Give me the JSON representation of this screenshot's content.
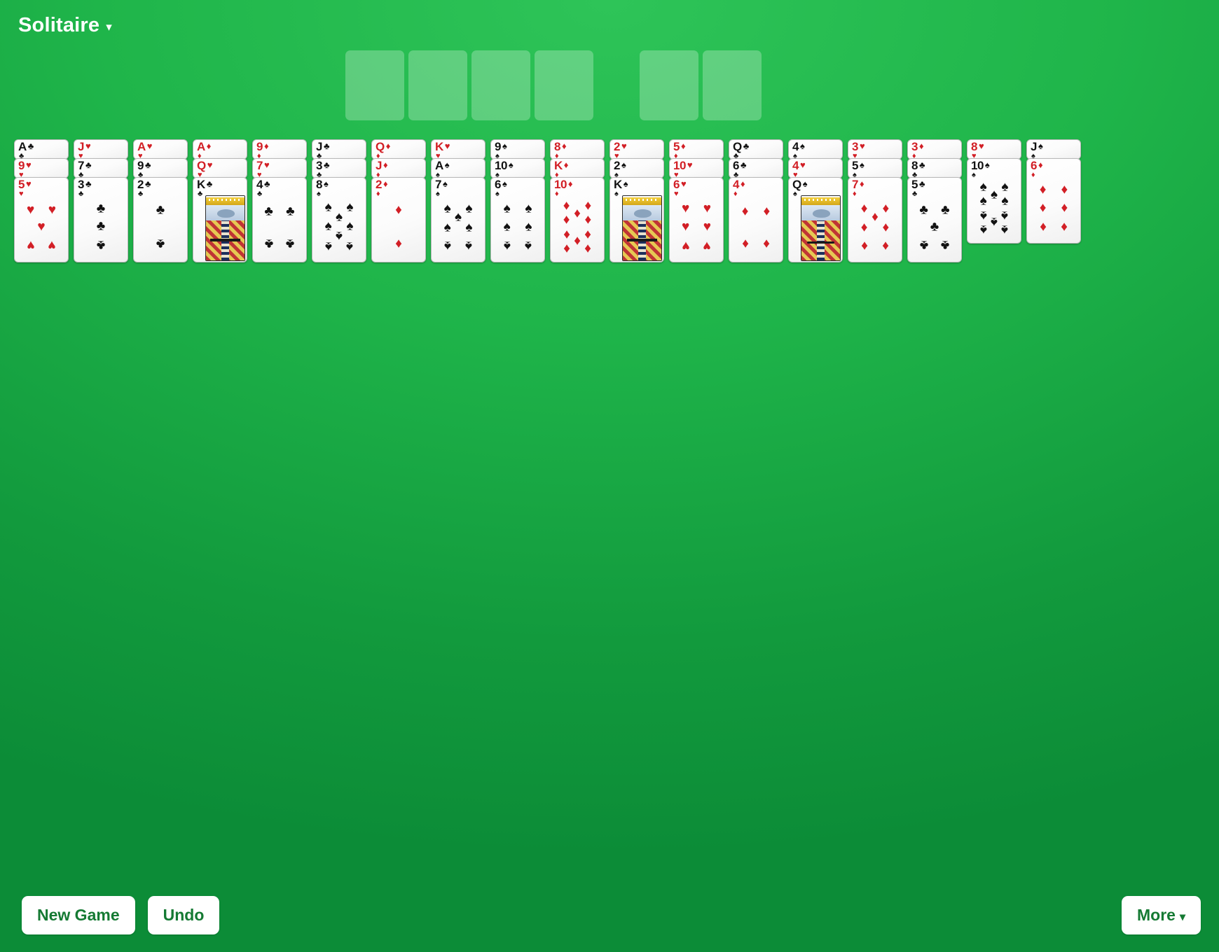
{
  "app": {
    "title": "Solitaire",
    "menu_caret": "▾",
    "table_color": "#1fb54a",
    "card_red": "#d21f26",
    "card_black": "#121212",
    "button_text_color": "#157a33"
  },
  "foundations": {
    "label": "foundation-piles",
    "slots": [
      {
        "id": "foundation-1",
        "card": ""
      },
      {
        "id": "foundation-2",
        "card": ""
      },
      {
        "id": "foundation-3",
        "card": ""
      },
      {
        "id": "foundation-4",
        "card": ""
      },
      {
        "id": "foundation-5",
        "card": "",
        "gap_before": true
      },
      {
        "id": "foundation-6",
        "card": ""
      }
    ]
  },
  "tableau": {
    "columns": [
      {
        "index": 1,
        "cards": [
          {
            "rank": "A",
            "suit": "♣",
            "color": "black"
          },
          {
            "rank": "9",
            "suit": "♥",
            "color": "red"
          },
          {
            "rank": "5",
            "suit": "♥",
            "color": "red"
          }
        ]
      },
      {
        "index": 2,
        "cards": [
          {
            "rank": "J",
            "suit": "♥",
            "color": "red"
          },
          {
            "rank": "7",
            "suit": "♣",
            "color": "black"
          },
          {
            "rank": "3",
            "suit": "♣",
            "color": "black"
          }
        ]
      },
      {
        "index": 3,
        "cards": [
          {
            "rank": "A",
            "suit": "♥",
            "color": "red"
          },
          {
            "rank": "9",
            "suit": "♣",
            "color": "black"
          },
          {
            "rank": "2",
            "suit": "♣",
            "color": "black"
          }
        ]
      },
      {
        "index": 4,
        "cards": [
          {
            "rank": "A",
            "suit": "♦",
            "color": "red"
          },
          {
            "rank": "Q",
            "suit": "♥",
            "color": "red"
          },
          {
            "rank": "K",
            "suit": "♣",
            "color": "black"
          }
        ]
      },
      {
        "index": 5,
        "cards": [
          {
            "rank": "9",
            "suit": "♦",
            "color": "red"
          },
          {
            "rank": "7",
            "suit": "♥",
            "color": "red"
          },
          {
            "rank": "4",
            "suit": "♣",
            "color": "black"
          }
        ]
      },
      {
        "index": 6,
        "cards": [
          {
            "rank": "J",
            "suit": "♣",
            "color": "black"
          },
          {
            "rank": "3",
            "suit": "♣",
            "color": "black"
          },
          {
            "rank": "8",
            "suit": "♠",
            "color": "black"
          }
        ]
      },
      {
        "index": 7,
        "cards": [
          {
            "rank": "Q",
            "suit": "♦",
            "color": "red"
          },
          {
            "rank": "J",
            "suit": "♦",
            "color": "red"
          },
          {
            "rank": "2",
            "suit": "♦",
            "color": "red"
          }
        ]
      },
      {
        "index": 8,
        "cards": [
          {
            "rank": "K",
            "suit": "♥",
            "color": "red"
          },
          {
            "rank": "A",
            "suit": "♠",
            "color": "black"
          },
          {
            "rank": "7",
            "suit": "♠",
            "color": "black"
          }
        ]
      },
      {
        "index": 9,
        "cards": [
          {
            "rank": "9",
            "suit": "♠",
            "color": "black"
          },
          {
            "rank": "10",
            "suit": "♠",
            "color": "black"
          },
          {
            "rank": "6",
            "suit": "♠",
            "color": "black"
          }
        ]
      },
      {
        "index": 10,
        "cards": [
          {
            "rank": "8",
            "suit": "♦",
            "color": "red"
          },
          {
            "rank": "K",
            "suit": "♦",
            "color": "red"
          },
          {
            "rank": "10",
            "suit": "♦",
            "color": "red"
          }
        ]
      },
      {
        "index": 11,
        "cards": [
          {
            "rank": "2",
            "suit": "♥",
            "color": "red"
          },
          {
            "rank": "2",
            "suit": "♠",
            "color": "black"
          },
          {
            "rank": "K",
            "suit": "♠",
            "color": "black"
          }
        ]
      },
      {
        "index": 12,
        "cards": [
          {
            "rank": "5",
            "suit": "♦",
            "color": "red"
          },
          {
            "rank": "10",
            "suit": "♥",
            "color": "red"
          },
          {
            "rank": "6",
            "suit": "♥",
            "color": "red"
          }
        ]
      },
      {
        "index": 13,
        "cards": [
          {
            "rank": "Q",
            "suit": "♣",
            "color": "black"
          },
          {
            "rank": "6",
            "suit": "♣",
            "color": "black"
          },
          {
            "rank": "4",
            "suit": "♦",
            "color": "red"
          }
        ]
      },
      {
        "index": 14,
        "cards": [
          {
            "rank": "4",
            "suit": "♠",
            "color": "black"
          },
          {
            "rank": "4",
            "suit": "♥",
            "color": "red"
          },
          {
            "rank": "Q",
            "suit": "♠",
            "color": "black"
          }
        ]
      },
      {
        "index": 15,
        "cards": [
          {
            "rank": "3",
            "suit": "♥",
            "color": "red"
          },
          {
            "rank": "5",
            "suit": "♠",
            "color": "black"
          },
          {
            "rank": "7",
            "suit": "♦",
            "color": "red"
          }
        ]
      },
      {
        "index": 16,
        "cards": [
          {
            "rank": "3",
            "suit": "♦",
            "color": "red"
          },
          {
            "rank": "8",
            "suit": "♣",
            "color": "black"
          },
          {
            "rank": "5",
            "suit": "♣",
            "color": "black"
          }
        ]
      },
      {
        "index": 17,
        "cards": [
          {
            "rank": "8",
            "suit": "♥",
            "color": "red"
          },
          {
            "rank": "10",
            "suit": "♠",
            "color": "black"
          }
        ]
      },
      {
        "index": 18,
        "cards": [
          {
            "rank": "J",
            "suit": "♠",
            "color": "black"
          },
          {
            "rank": "6",
            "suit": "♦",
            "color": "red"
          }
        ]
      }
    ]
  },
  "controls": {
    "new_game_label": "New Game",
    "undo_label": "Undo",
    "more_label": "More",
    "more_caret": "▾"
  }
}
